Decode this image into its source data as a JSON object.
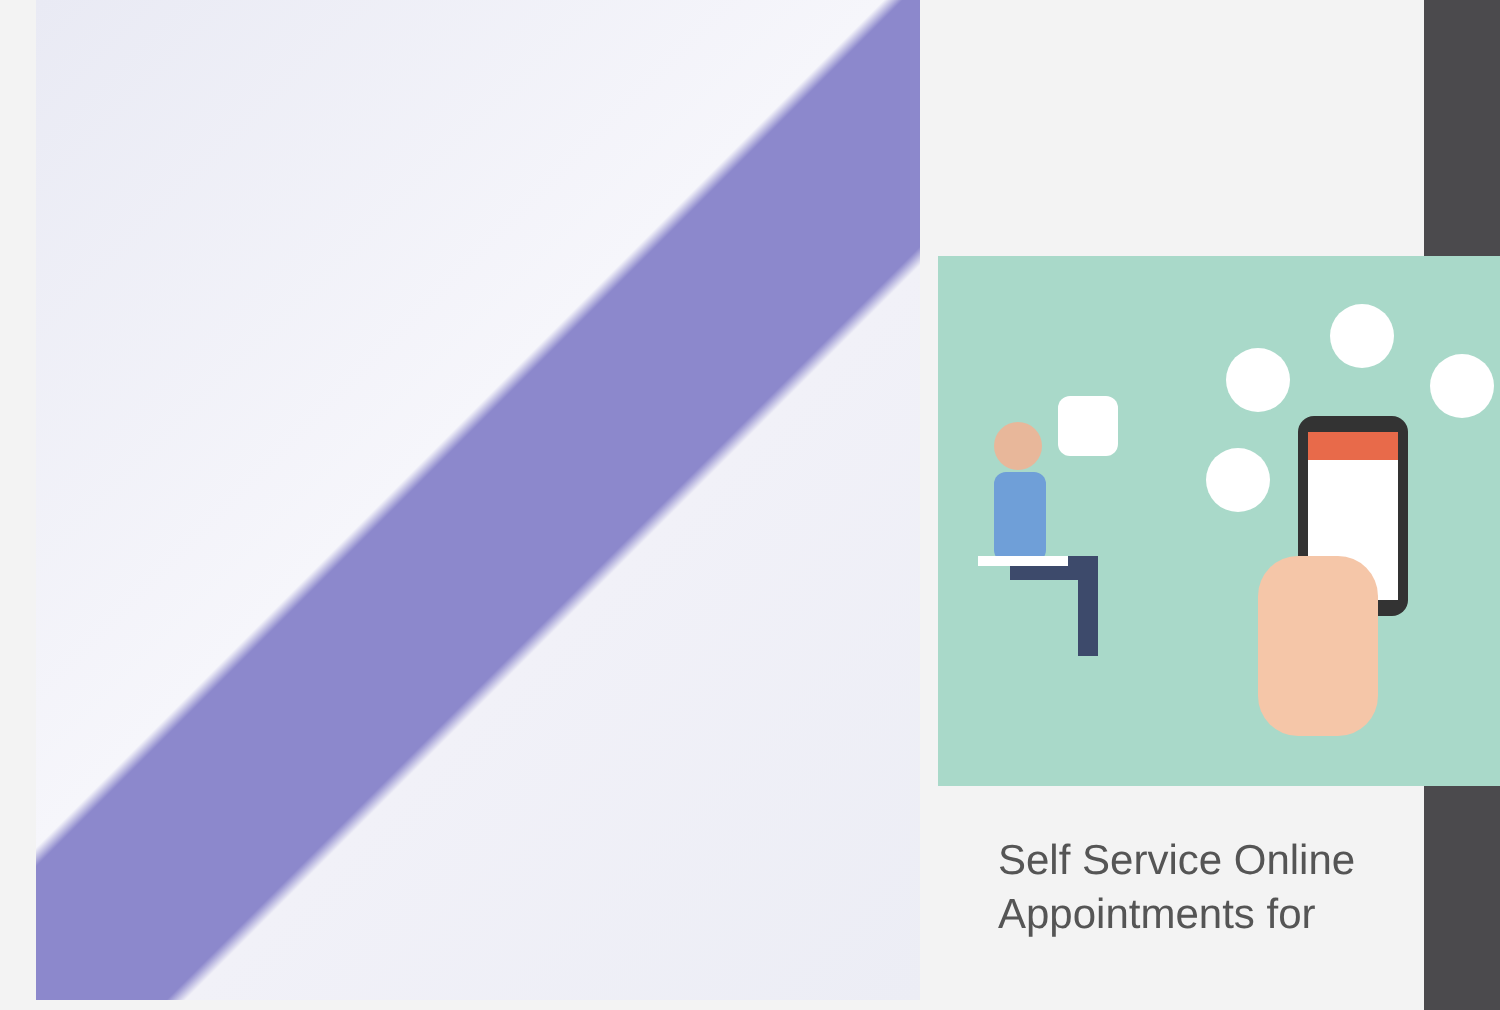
{
  "article_card": {
    "title": "Self Service Online Appointments for"
  }
}
